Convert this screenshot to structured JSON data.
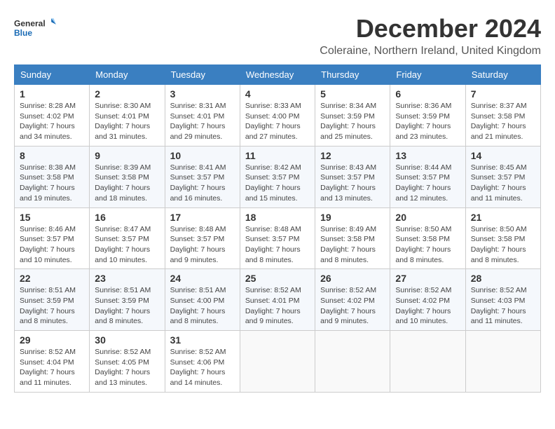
{
  "logo": {
    "line1": "General",
    "line2": "Blue"
  },
  "title": "December 2024",
  "subtitle": "Coleraine, Northern Ireland, United Kingdom",
  "weekdays": [
    "Sunday",
    "Monday",
    "Tuesday",
    "Wednesday",
    "Thursday",
    "Friday",
    "Saturday"
  ],
  "weeks": [
    [
      {
        "day": "1",
        "sunrise": "8:28 AM",
        "sunset": "4:02 PM",
        "daylight": "7 hours and 34 minutes."
      },
      {
        "day": "2",
        "sunrise": "8:30 AM",
        "sunset": "4:01 PM",
        "daylight": "7 hours and 31 minutes."
      },
      {
        "day": "3",
        "sunrise": "8:31 AM",
        "sunset": "4:01 PM",
        "daylight": "7 hours and 29 minutes."
      },
      {
        "day": "4",
        "sunrise": "8:33 AM",
        "sunset": "4:00 PM",
        "daylight": "7 hours and 27 minutes."
      },
      {
        "day": "5",
        "sunrise": "8:34 AM",
        "sunset": "3:59 PM",
        "daylight": "7 hours and 25 minutes."
      },
      {
        "day": "6",
        "sunrise": "8:36 AM",
        "sunset": "3:59 PM",
        "daylight": "7 hours and 23 minutes."
      },
      {
        "day": "7",
        "sunrise": "8:37 AM",
        "sunset": "3:58 PM",
        "daylight": "7 hours and 21 minutes."
      }
    ],
    [
      {
        "day": "8",
        "sunrise": "8:38 AM",
        "sunset": "3:58 PM",
        "daylight": "7 hours and 19 minutes."
      },
      {
        "day": "9",
        "sunrise": "8:39 AM",
        "sunset": "3:58 PM",
        "daylight": "7 hours and 18 minutes."
      },
      {
        "day": "10",
        "sunrise": "8:41 AM",
        "sunset": "3:57 PM",
        "daylight": "7 hours and 16 minutes."
      },
      {
        "day": "11",
        "sunrise": "8:42 AM",
        "sunset": "3:57 PM",
        "daylight": "7 hours and 15 minutes."
      },
      {
        "day": "12",
        "sunrise": "8:43 AM",
        "sunset": "3:57 PM",
        "daylight": "7 hours and 13 minutes."
      },
      {
        "day": "13",
        "sunrise": "8:44 AM",
        "sunset": "3:57 PM",
        "daylight": "7 hours and 12 minutes."
      },
      {
        "day": "14",
        "sunrise": "8:45 AM",
        "sunset": "3:57 PM",
        "daylight": "7 hours and 11 minutes."
      }
    ],
    [
      {
        "day": "15",
        "sunrise": "8:46 AM",
        "sunset": "3:57 PM",
        "daylight": "7 hours and 10 minutes."
      },
      {
        "day": "16",
        "sunrise": "8:47 AM",
        "sunset": "3:57 PM",
        "daylight": "7 hours and 10 minutes."
      },
      {
        "day": "17",
        "sunrise": "8:48 AM",
        "sunset": "3:57 PM",
        "daylight": "7 hours and 9 minutes."
      },
      {
        "day": "18",
        "sunrise": "8:48 AM",
        "sunset": "3:57 PM",
        "daylight": "7 hours and 8 minutes."
      },
      {
        "day": "19",
        "sunrise": "8:49 AM",
        "sunset": "3:58 PM",
        "daylight": "7 hours and 8 minutes."
      },
      {
        "day": "20",
        "sunrise": "8:50 AM",
        "sunset": "3:58 PM",
        "daylight": "7 hours and 8 minutes."
      },
      {
        "day": "21",
        "sunrise": "8:50 AM",
        "sunset": "3:58 PM",
        "daylight": "7 hours and 8 minutes."
      }
    ],
    [
      {
        "day": "22",
        "sunrise": "8:51 AM",
        "sunset": "3:59 PM",
        "daylight": "7 hours and 8 minutes."
      },
      {
        "day": "23",
        "sunrise": "8:51 AM",
        "sunset": "3:59 PM",
        "daylight": "7 hours and 8 minutes."
      },
      {
        "day": "24",
        "sunrise": "8:51 AM",
        "sunset": "4:00 PM",
        "daylight": "7 hours and 8 minutes."
      },
      {
        "day": "25",
        "sunrise": "8:52 AM",
        "sunset": "4:01 PM",
        "daylight": "7 hours and 9 minutes."
      },
      {
        "day": "26",
        "sunrise": "8:52 AM",
        "sunset": "4:02 PM",
        "daylight": "7 hours and 9 minutes."
      },
      {
        "day": "27",
        "sunrise": "8:52 AM",
        "sunset": "4:02 PM",
        "daylight": "7 hours and 10 minutes."
      },
      {
        "day": "28",
        "sunrise": "8:52 AM",
        "sunset": "4:03 PM",
        "daylight": "7 hours and 11 minutes."
      }
    ],
    [
      {
        "day": "29",
        "sunrise": "8:52 AM",
        "sunset": "4:04 PM",
        "daylight": "7 hours and 11 minutes."
      },
      {
        "day": "30",
        "sunrise": "8:52 AM",
        "sunset": "4:05 PM",
        "daylight": "7 hours and 13 minutes."
      },
      {
        "day": "31",
        "sunrise": "8:52 AM",
        "sunset": "4:06 PM",
        "daylight": "7 hours and 14 minutes."
      },
      null,
      null,
      null,
      null
    ]
  ]
}
